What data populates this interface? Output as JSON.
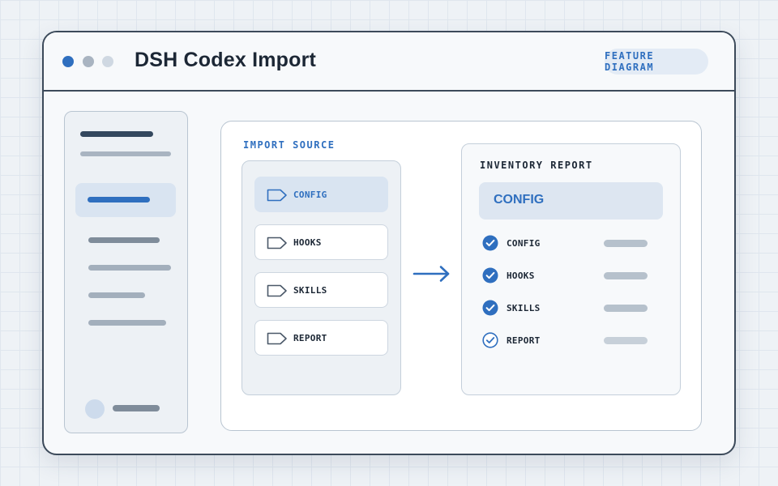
{
  "window": {
    "title": "DSH Codex Import",
    "badge": "FEATURE DIAGRAM"
  },
  "import_source": {
    "label": "IMPORT SOURCE",
    "items": [
      {
        "label": "CONFIG",
        "active": true
      },
      {
        "label": "HOOKS",
        "active": false
      },
      {
        "label": "SKILLS",
        "active": false
      },
      {
        "label": "REPORT",
        "active": false
      }
    ]
  },
  "inventory_report": {
    "label": "INVENTORY REPORT",
    "banner": "CONFIG",
    "rows": [
      {
        "label": "CONFIG",
        "status": "checked"
      },
      {
        "label": "HOOKS",
        "status": "checked"
      },
      {
        "label": "SKILLS",
        "status": "checked"
      },
      {
        "label": "REPORT",
        "status": "outline-check"
      }
    ]
  },
  "icons": {
    "window_controls": "traffic-light-dots",
    "source_item": "tag-icon",
    "flow": "arrow-right-icon",
    "report_row_checked": "check-circle-filled-icon",
    "report_row_pending": "check-circle-outline-icon"
  },
  "colors": {
    "accent": "#2f6fbf",
    "border": "#3c4a5a",
    "panel_bg": "#edf1f5",
    "selected_bg": "#d9e4f1",
    "text_dark": "#1c2735"
  }
}
